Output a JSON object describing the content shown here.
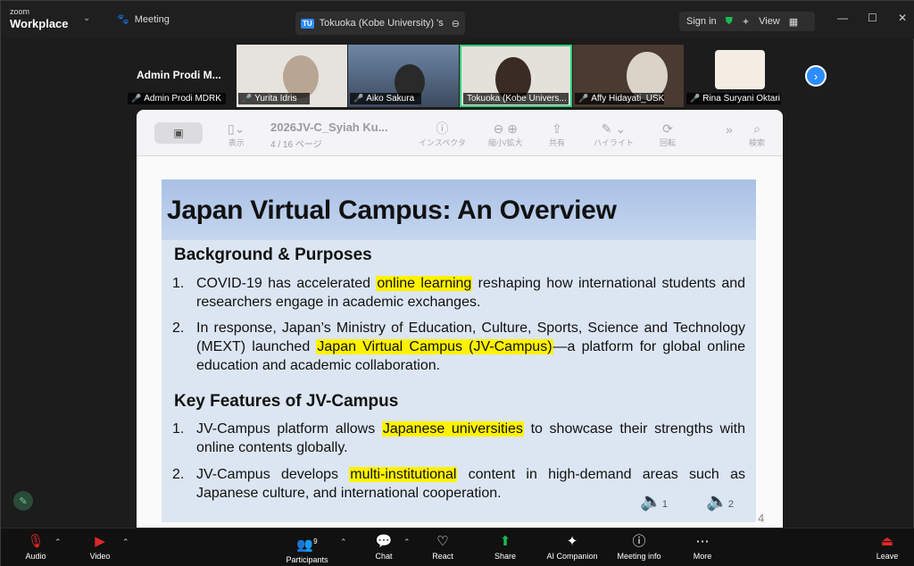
{
  "titlebar": {
    "brand_small": "zoom",
    "brand_large": "Workplace",
    "meeting_label": "Meeting",
    "share_tab_badge": "TU",
    "share_tab_title": "Tokuoka (Kobe University) 's sc",
    "signin_label": "Sign in",
    "view_label": "View"
  },
  "gallery": {
    "self_name_large": "Admin Prodi M...",
    "participants": [
      {
        "name": "Admin Prodi MDRK"
      },
      {
        "name": "Yurita Idris"
      },
      {
        "name": "Aiko Sakura"
      },
      {
        "name": "Tokuoka (Kobe Univers..."
      },
      {
        "name": "Affy Hidayati_USK"
      },
      {
        "name": "Rina Suryani Oktari"
      }
    ]
  },
  "viewer": {
    "doc_title": "2026JV-C_Syiah Ku...",
    "doc_page": "4 / 16 ページ",
    "toolbar": {
      "display": "表示",
      "inspector": "インスペクタ",
      "zoom": "縮小/拡大",
      "share": "共有",
      "highlight": "ハイライト",
      "rotate": "回転",
      "search": "検索"
    }
  },
  "slide": {
    "title": "Japan Virtual Campus: An Overview",
    "section1": "Background & Purposes",
    "s1_items": [
      {
        "num": "1.",
        "pre": "COVID-19 has accelerated ",
        "hl": "online learning",
        "post": " reshaping how international students and researchers engage in academic exchanges."
      },
      {
        "num": "2.",
        "pre": "In response, Japan’s Ministry of Education, Culture, Sports, Science and Technology (MEXT) launched ",
        "hl": "Japan Virtual Campus (JV-Campus)",
        "post": "—a platform for global online education and academic collaboration."
      }
    ],
    "section2": "Key Features of JV-Campus",
    "s2_items": [
      {
        "num": "1.",
        "pre": "JV-Campus platform allows ",
        "hl": "Japanese universities",
        "post": " to showcase their strengths with online contents globally."
      },
      {
        "num": "2.",
        "pre": "JV-Campus develops ",
        "hl": "multi-institutional",
        "post": " content in high-demand areas such as Japanese culture, and international cooperation."
      }
    ],
    "speaker1": "1",
    "speaker2": "2",
    "page_number": "4"
  },
  "bottombar": {
    "audio": "Audio",
    "video": "Video",
    "participants": "Participants",
    "participants_count": "9",
    "chat": "Chat",
    "react": "React",
    "share": "Share",
    "ai_companion": "AI Companion",
    "meeting_info": "Meeting info",
    "more": "More",
    "leave": "Leave"
  },
  "colors": {
    "accent_blue": "#2d8cff",
    "share_green": "#1db954",
    "mute_red": "#e02828",
    "highlight_yellow": "#fff200"
  }
}
